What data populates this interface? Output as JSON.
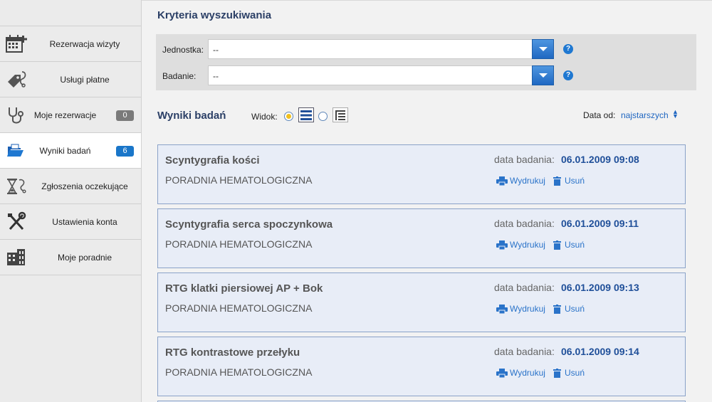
{
  "sidebar": {
    "items": [
      {
        "label": "Rezerwacja wizyty",
        "icon": "calendar-plus-icon"
      },
      {
        "label": "Usługi płatne",
        "icon": "tag-stethoscope-icon"
      },
      {
        "label": "Moje rezerwacje",
        "icon": "stethoscope-icon",
        "badge": "0"
      },
      {
        "label": "Wyniki badań",
        "icon": "folder-open-icon",
        "badge": "6"
      },
      {
        "label": "Zgłoszenia oczekujące",
        "icon": "hourglass-stethoscope-icon"
      },
      {
        "label": "Ustawienia konta",
        "icon": "tools-icon"
      },
      {
        "label": "Moje poradnie",
        "icon": "building-icon"
      }
    ]
  },
  "criteria": {
    "title": "Kryteria wyszukiwania",
    "unit_label": "Jednostka:",
    "unit_value": "--",
    "exam_label": "Badanie:",
    "exam_value": "--",
    "help": "?"
  },
  "results": {
    "title": "Wyniki badań",
    "view_label": "Widok:",
    "date_from_label": "Data od:",
    "date_from_value": "najstarszych",
    "date_label": "data badania:",
    "print_label": "Wydrukuj",
    "delete_label": "Usuń",
    "items": [
      {
        "title": "Scyntygrafia kości",
        "clinic": "PORADNIA HEMATOLOGICZNA",
        "date": "06.01.2009 09:08"
      },
      {
        "title": "Scyntygrafia serca spoczynkowa",
        "clinic": "PORADNIA HEMATOLOGICZNA",
        "date": "06.01.2009 09:11"
      },
      {
        "title": "RTG klatki piersiowej AP + Bok",
        "clinic": "PORADNIA HEMATOLOGICZNA",
        "date": "06.01.2009 09:13"
      },
      {
        "title": "RTG kontrastowe przełyku",
        "clinic": "PORADNIA HEMATOLOGICZNA",
        "date": "06.01.2009 09:14"
      }
    ]
  },
  "colors": {
    "accent": "#1f66c1",
    "heading": "#2b3f66",
    "card_bg": "#e8edf7",
    "card_border": "#8aa2c8"
  }
}
